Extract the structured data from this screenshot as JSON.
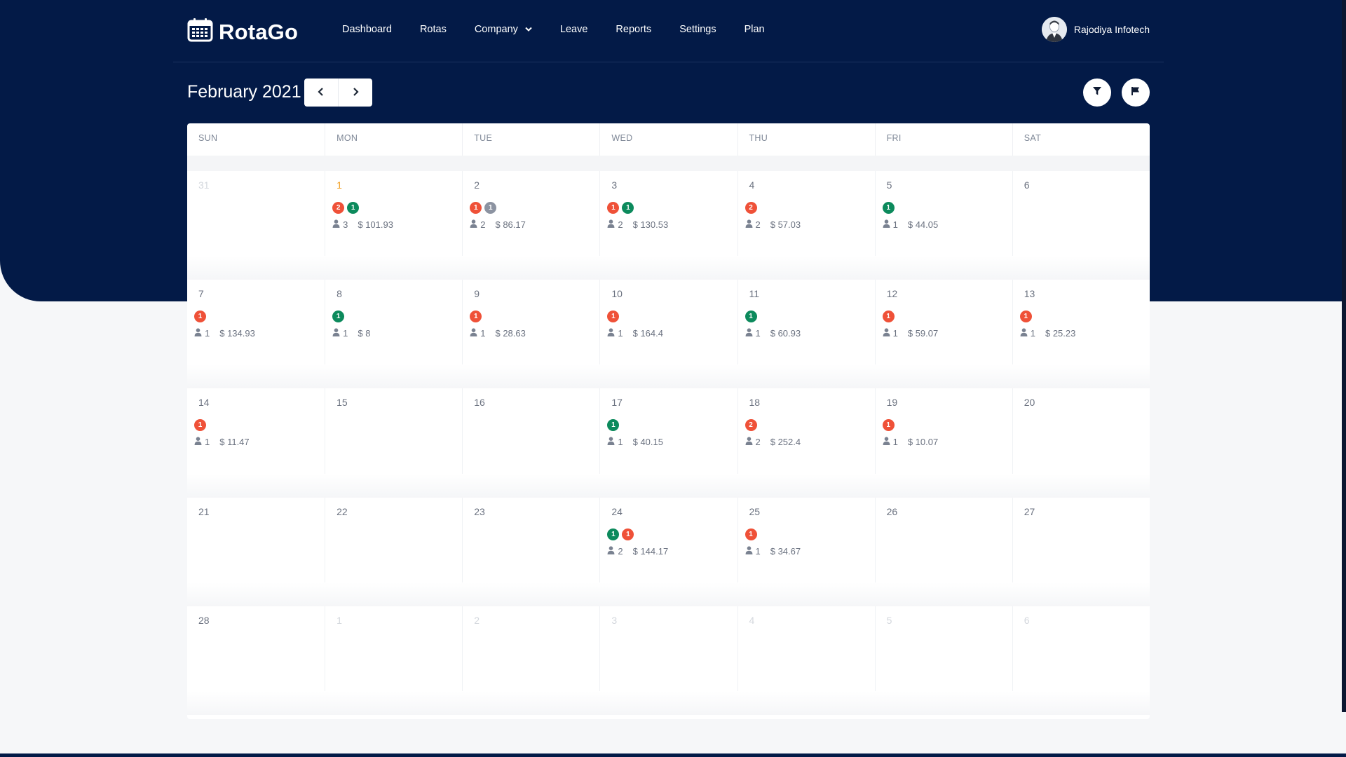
{
  "app": {
    "name": "RotaGo"
  },
  "nav": {
    "items": [
      {
        "label": "Dashboard",
        "name": "nav-dashboard",
        "dropdown": false
      },
      {
        "label": "Rotas",
        "name": "nav-rotas",
        "dropdown": false
      },
      {
        "label": "Company",
        "name": "nav-company",
        "dropdown": true
      },
      {
        "label": "Leave",
        "name": "nav-leave",
        "dropdown": false
      },
      {
        "label": "Reports",
        "name": "nav-reports",
        "dropdown": false
      },
      {
        "label": "Settings",
        "name": "nav-settings",
        "dropdown": false
      },
      {
        "label": "Plan",
        "name": "nav-plan",
        "dropdown": false
      }
    ]
  },
  "user": {
    "name": "Rajodiya Infotech"
  },
  "calendar": {
    "month_label": "February 2021",
    "prev_icon": "chevron-left-icon",
    "next_icon": "chevron-right-icon",
    "filter_icon": "filter-icon",
    "flag_icon": "flag-icon",
    "weekdays": [
      "SUN",
      "MON",
      "TUE",
      "WED",
      "THU",
      "FRI",
      "SAT"
    ],
    "currency": "$",
    "colors": {
      "red": "#ef5138",
      "green": "#0c8a5c",
      "gray": "#8c93a1",
      "today": "#f29d1d",
      "header_bg": "#031a47"
    },
    "weeks": [
      [
        {
          "num": "31",
          "other": true
        },
        {
          "num": "1",
          "today": true,
          "badges": [
            {
              "c": "red",
              "n": "2"
            },
            {
              "c": "green",
              "n": "1"
            }
          ],
          "emp": "3",
          "amt": "101.93"
        },
        {
          "num": "2",
          "badges": [
            {
              "c": "red",
              "n": "1"
            },
            {
              "c": "gray",
              "n": "1"
            }
          ],
          "emp": "2",
          "amt": "86.17"
        },
        {
          "num": "3",
          "badges": [
            {
              "c": "red",
              "n": "1"
            },
            {
              "c": "green",
              "n": "1"
            }
          ],
          "emp": "2",
          "amt": "130.53"
        },
        {
          "num": "4",
          "badges": [
            {
              "c": "red",
              "n": "2"
            }
          ],
          "emp": "2",
          "amt": "57.03"
        },
        {
          "num": "5",
          "badges": [
            {
              "c": "green",
              "n": "1"
            }
          ],
          "emp": "1",
          "amt": "44.05"
        },
        {
          "num": "6"
        }
      ],
      [
        {
          "num": "7",
          "badges": [
            {
              "c": "red",
              "n": "1"
            }
          ],
          "emp": "1",
          "amt": "134.93"
        },
        {
          "num": "8",
          "badges": [
            {
              "c": "green",
              "n": "1"
            }
          ],
          "emp": "1",
          "amt": "8"
        },
        {
          "num": "9",
          "badges": [
            {
              "c": "red",
              "n": "1"
            }
          ],
          "emp": "1",
          "amt": "28.63"
        },
        {
          "num": "10",
          "badges": [
            {
              "c": "red",
              "n": "1"
            }
          ],
          "emp": "1",
          "amt": "164.4"
        },
        {
          "num": "11",
          "badges": [
            {
              "c": "green",
              "n": "1"
            }
          ],
          "emp": "1",
          "amt": "60.93"
        },
        {
          "num": "12",
          "badges": [
            {
              "c": "red",
              "n": "1"
            }
          ],
          "emp": "1",
          "amt": "59.07"
        },
        {
          "num": "13",
          "badges": [
            {
              "c": "red",
              "n": "1"
            }
          ],
          "emp": "1",
          "amt": "25.23"
        }
      ],
      [
        {
          "num": "14",
          "badges": [
            {
              "c": "red",
              "n": "1"
            }
          ],
          "emp": "1",
          "amt": "11.47"
        },
        {
          "num": "15"
        },
        {
          "num": "16"
        },
        {
          "num": "17",
          "badges": [
            {
              "c": "green",
              "n": "1"
            }
          ],
          "emp": "1",
          "amt": "40.15"
        },
        {
          "num": "18",
          "badges": [
            {
              "c": "red",
              "n": "2"
            }
          ],
          "emp": "2",
          "amt": "252.4"
        },
        {
          "num": "19",
          "badges": [
            {
              "c": "red",
              "n": "1"
            }
          ],
          "emp": "1",
          "amt": "10.07"
        },
        {
          "num": "20"
        }
      ],
      [
        {
          "num": "21"
        },
        {
          "num": "22"
        },
        {
          "num": "23"
        },
        {
          "num": "24",
          "badges": [
            {
              "c": "green",
              "n": "1"
            },
            {
              "c": "red",
              "n": "1"
            }
          ],
          "emp": "2",
          "amt": "144.17"
        },
        {
          "num": "25",
          "badges": [
            {
              "c": "red",
              "n": "1"
            }
          ],
          "emp": "1",
          "amt": "34.67"
        },
        {
          "num": "26"
        },
        {
          "num": "27"
        }
      ],
      [
        {
          "num": "28"
        },
        {
          "num": "1",
          "other": true
        },
        {
          "num": "2",
          "other": true
        },
        {
          "num": "3",
          "other": true
        },
        {
          "num": "4",
          "other": true
        },
        {
          "num": "5",
          "other": true
        },
        {
          "num": "6",
          "other": true
        }
      ]
    ]
  }
}
